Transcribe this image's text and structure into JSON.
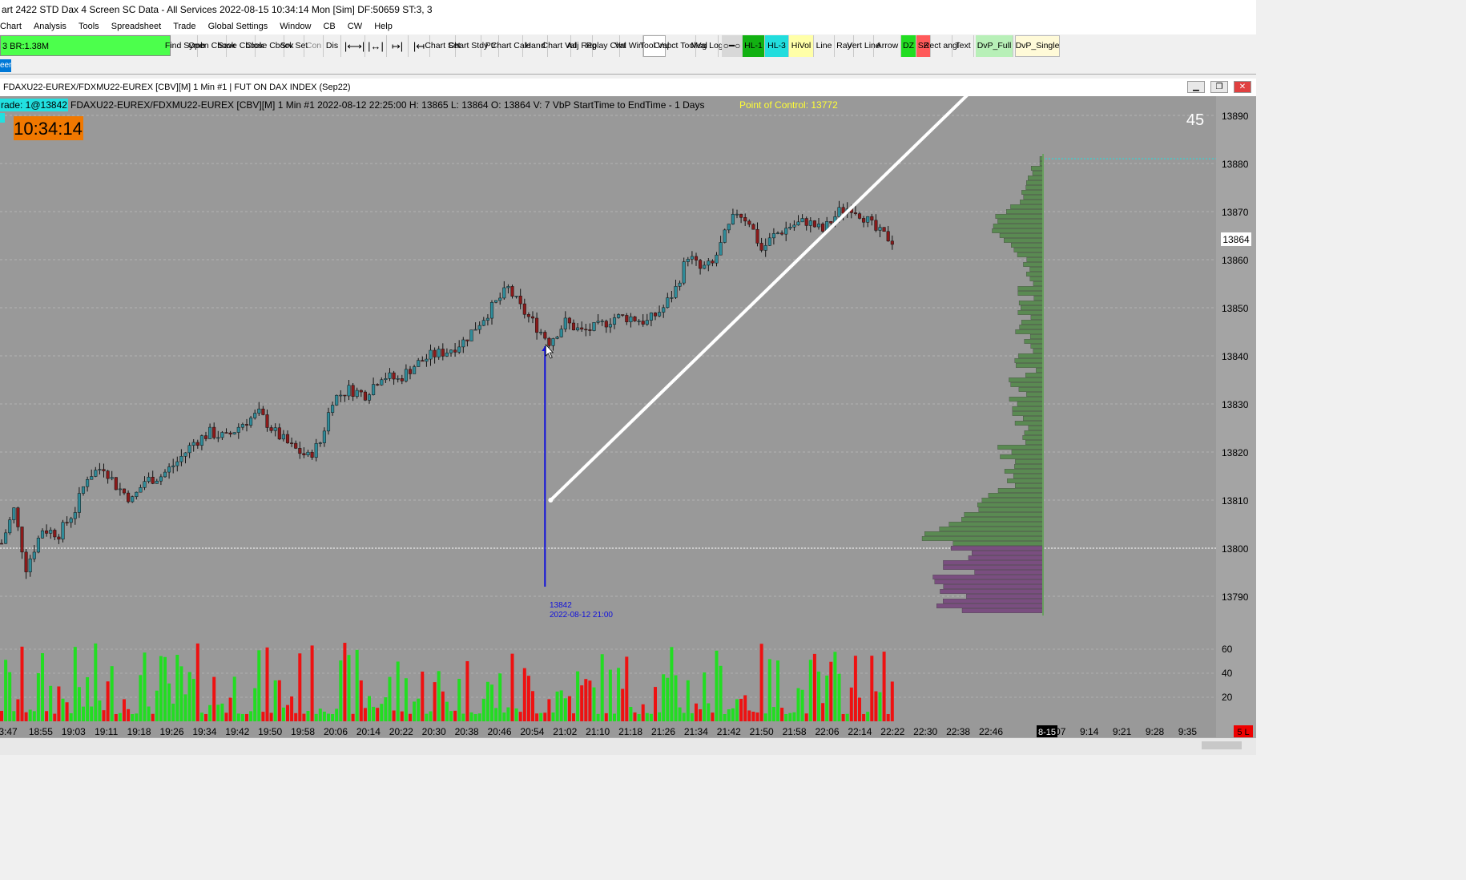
{
  "window": {
    "title": "art 2422 STD Dax 4 Screen  SC Data - All Services 2022-08-15  10:34:14 Mon [Sim]  DF:50659  ST:3, 3"
  },
  "menu": [
    "Chart",
    "Analysis",
    "Tools",
    "Spreadsheet",
    "Trade",
    "Global Settings",
    "Window",
    "CB",
    "CW",
    "Help"
  ],
  "toolbar": {
    "symbol_field": "3  BR:1.38M",
    "buttons": [
      "Find Symb",
      "Open Cbook",
      "Save Cbook",
      "Close Cbook",
      "Srv Set",
      "Con",
      "Dis",
      "Chart Set",
      "Chart Stdy",
      "Ptr",
      "Chart Calc",
      "Hand",
      "Chart Val",
      "Adj Reg",
      "Rplay Chrt",
      "Val Wind",
      "Tool Val",
      "Cmpct ToolVal",
      "Msg Log",
      "HL-1",
      "HL-3",
      "HiVol",
      "Line",
      "Ray",
      "Vert Line",
      "Arrow",
      "DZ",
      "SZ",
      "Rect angl",
      "Text",
      "DvP_Full",
      "DvP_Single"
    ]
  },
  "tab": {
    "label": "een"
  },
  "chart": {
    "window_title": "FDAXU22-EUREX/FDXMU22-EUREX [CBV][M]  1 Min  #1 | FUT ON DAX INDEX (Sep22)",
    "trade_badge": "rade: 1@13842",
    "info_line": "FDAXU22-EUREX/FDXMU22-EUREX [CBV][M]  1 Min   #1 2022-08-12 22:25:00 H: 13865  L: 13864  O: 13864  V: 7  VbP StartTime to EndTime - 1 Days",
    "poc_label": "Point of Control: 13772",
    "clock": "10:34:14",
    "countdown": "45",
    "current_price": "13864",
    "marker_price": "13842",
    "marker_time": "2022-08-12  21:00",
    "time_labels": [
      "3:47",
      "18:55",
      "19:03",
      "19:11",
      "19:18",
      "19:26",
      "19:34",
      "19:42",
      "19:50",
      "19:58",
      "20:06",
      "20:14",
      "20:22",
      "20:30",
      "20:38",
      "20:46",
      "20:54",
      "21:02",
      "21:10",
      "21:18",
      "21:26",
      "21:34",
      "21:42",
      "21:50",
      "21:58",
      "22:06",
      "22:14",
      "22:22",
      "22:30",
      "22:38",
      "22:46",
      "8-15",
      "9:07",
      "9:14",
      "9:21",
      "9:28",
      "9:35"
    ],
    "date_badge": "8-15",
    "bottom_right_badge": "5 L",
    "price_ticks": [
      "13890",
      "13880",
      "13870",
      "13860",
      "13850",
      "13840",
      "13830",
      "13820",
      "13810",
      "13800",
      "13790"
    ],
    "volume_ticks": [
      "60",
      "40",
      "20"
    ],
    "colors": {
      "background": "#999999",
      "up": "#2f8c9a",
      "down": "#8b1a1a",
      "vol_up": "#22dd22",
      "vol_down": "#ee1111",
      "profile_upper": "#5a8a52",
      "profile_lower": "#7a4e80",
      "marker": "#1010dd",
      "trendline": "#ffffff",
      "poc_text": "#ffff33",
      "clock_bg": "#f07800"
    }
  },
  "chart_data": {
    "type": "candlestick",
    "title": "FDAXU22-EUREX/FDXMU22-EUREX [CBV][M] 1 Min",
    "ylim": [
      13785,
      13893
    ],
    "x_range": [
      "18:47",
      "22:25"
    ],
    "close_path": [
      {
        "x": "18:47",
        "y": 13801
      },
      {
        "x": "18:50",
        "y": 13808
      },
      {
        "x": "18:53",
        "y": 13796
      },
      {
        "x": "18:57",
        "y": 13804
      },
      {
        "x": "19:01",
        "y": 13803
      },
      {
        "x": "19:05",
        "y": 13808
      },
      {
        "x": "19:08",
        "y": 13815
      },
      {
        "x": "19:12",
        "y": 13817
      },
      {
        "x": "19:15",
        "y": 13813
      },
      {
        "x": "19:19",
        "y": 13810
      },
      {
        "x": "19:22",
        "y": 13814
      },
      {
        "x": "19:26",
        "y": 13815
      },
      {
        "x": "19:30",
        "y": 13818
      },
      {
        "x": "19:34",
        "y": 13822
      },
      {
        "x": "19:38",
        "y": 13824
      },
      {
        "x": "19:42",
        "y": 13823
      },
      {
        "x": "19:46",
        "y": 13826
      },
      {
        "x": "19:50",
        "y": 13828
      },
      {
        "x": "19:54",
        "y": 13824
      },
      {
        "x": "19:58",
        "y": 13821
      },
      {
        "x": "20:02",
        "y": 13819
      },
      {
        "x": "20:05",
        "y": 13822
      },
      {
        "x": "20:08",
        "y": 13831
      },
      {
        "x": "20:12",
        "y": 13833
      },
      {
        "x": "20:16",
        "y": 13832
      },
      {
        "x": "20:20",
        "y": 13836
      },
      {
        "x": "20:24",
        "y": 13835
      },
      {
        "x": "20:28",
        "y": 13838
      },
      {
        "x": "20:32",
        "y": 13840
      },
      {
        "x": "20:36",
        "y": 13841
      },
      {
        "x": "20:40",
        "y": 13843
      },
      {
        "x": "20:44",
        "y": 13847
      },
      {
        "x": "20:48",
        "y": 13851
      },
      {
        "x": "20:51",
        "y": 13854
      },
      {
        "x": "20:54",
        "y": 13850
      },
      {
        "x": "20:58",
        "y": 13846
      },
      {
        "x": "21:01",
        "y": 13843
      },
      {
        "x": "21:05",
        "y": 13847
      },
      {
        "x": "21:09",
        "y": 13845
      },
      {
        "x": "21:13",
        "y": 13846
      },
      {
        "x": "21:17",
        "y": 13848
      },
      {
        "x": "21:21",
        "y": 13848
      },
      {
        "x": "21:25",
        "y": 13847
      },
      {
        "x": "21:29",
        "y": 13850
      },
      {
        "x": "21:32",
        "y": 13854
      },
      {
        "x": "21:35",
        "y": 13861
      },
      {
        "x": "21:38",
        "y": 13858
      },
      {
        "x": "21:41",
        "y": 13859
      },
      {
        "x": "21:44",
        "y": 13865
      },
      {
        "x": "21:47",
        "y": 13870
      },
      {
        "x": "21:50",
        "y": 13868
      },
      {
        "x": "21:53",
        "y": 13862
      },
      {
        "x": "21:56",
        "y": 13865
      },
      {
        "x": "22:00",
        "y": 13867
      },
      {
        "x": "22:04",
        "y": 13868
      },
      {
        "x": "22:08",
        "y": 13866
      },
      {
        "x": "22:12",
        "y": 13870
      },
      {
        "x": "22:15",
        "y": 13871
      },
      {
        "x": "22:18",
        "y": 13869
      },
      {
        "x": "22:21",
        "y": 13866
      },
      {
        "x": "22:25",
        "y": 13864
      }
    ],
    "marker": {
      "x": "21:00",
      "y": 13842
    },
    "trendline": [
      {
        "x": "21:01",
        "y": 13810
      },
      {
        "x": "22:12",
        "y": 13868
      }
    ]
  }
}
